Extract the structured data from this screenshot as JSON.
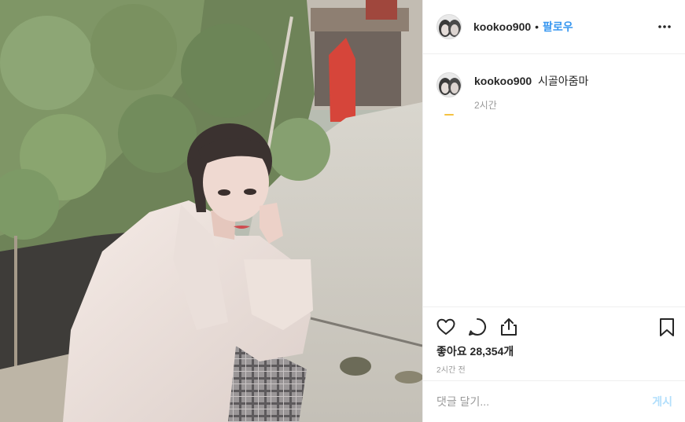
{
  "post": {
    "username": "kookoo900",
    "follow_label": "팔로우",
    "dot": "•",
    "caption_text": "시골아줌마",
    "caption_time": "2시간",
    "likes_text": "좋아요 28,354개",
    "posted_time": "2시간 전",
    "comment_placeholder": "댓글 달기...",
    "post_label": "게시"
  },
  "icons": {
    "more": "more-options-icon",
    "like": "heart-icon",
    "comment": "comment-icon",
    "share": "share-icon",
    "save": "bookmark-icon"
  },
  "colors": {
    "follow": "#3897f0",
    "post_button_disabled": "#b2dffc",
    "secondary_text": "#999999",
    "divider": "#efefef"
  }
}
